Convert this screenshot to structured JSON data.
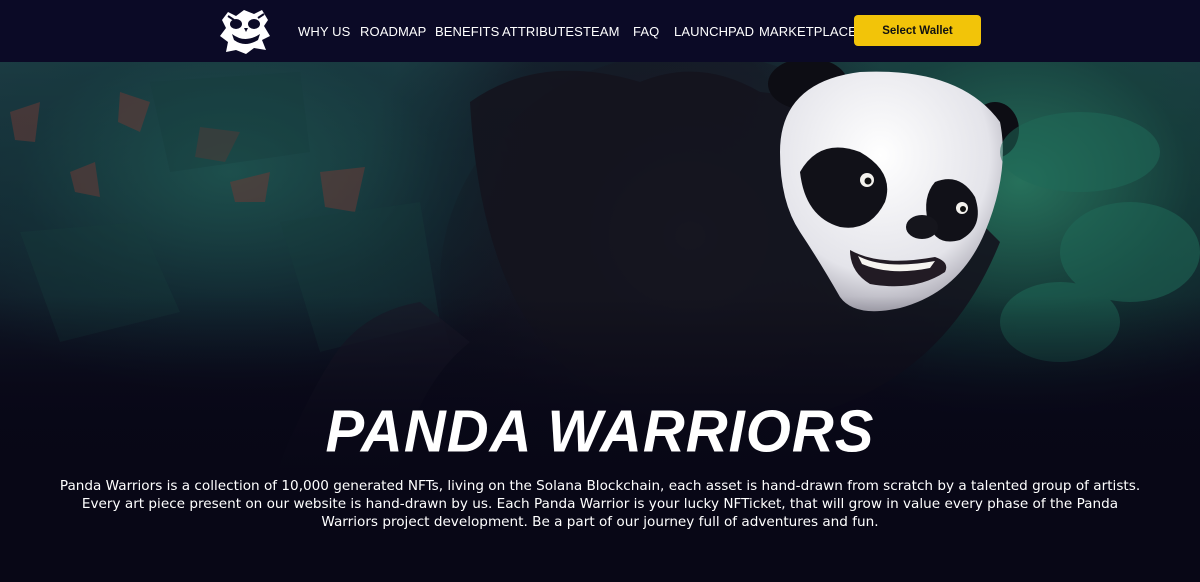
{
  "nav": {
    "items": [
      {
        "label": "WHY US"
      },
      {
        "label": "ROADMAP"
      },
      {
        "label": "BENEFITS"
      },
      {
        "label": "ATTRIBUTES"
      },
      {
        "label": "TEAM"
      },
      {
        "label": "FAQ"
      },
      {
        "label": "LAUNCHPAD"
      },
      {
        "label": "MARKETPLACE"
      }
    ],
    "wallet_button": "Select Wallet",
    "logo_icon": "panda-warrior-logo-icon"
  },
  "hero": {
    "title": "PANDA WARRIORS",
    "description": "Panda Warriors is a collection of 10,000 generated NFTs, living on the Solana Blockchain, each asset is hand-drawn from scratch by a talented group of artists. Every art piece present on our website is hand-drawn by us. Each Panda Warrior is your lucky NFTicket, that will grow in value every phase of the Panda Warriors project development. Be a part of our journey full of adventures and fun.",
    "artwork_icon": "panda-artwork"
  },
  "colors": {
    "nav_bg": "#0b0a26",
    "accent": "#f2c409",
    "page_bg": "#080716"
  }
}
